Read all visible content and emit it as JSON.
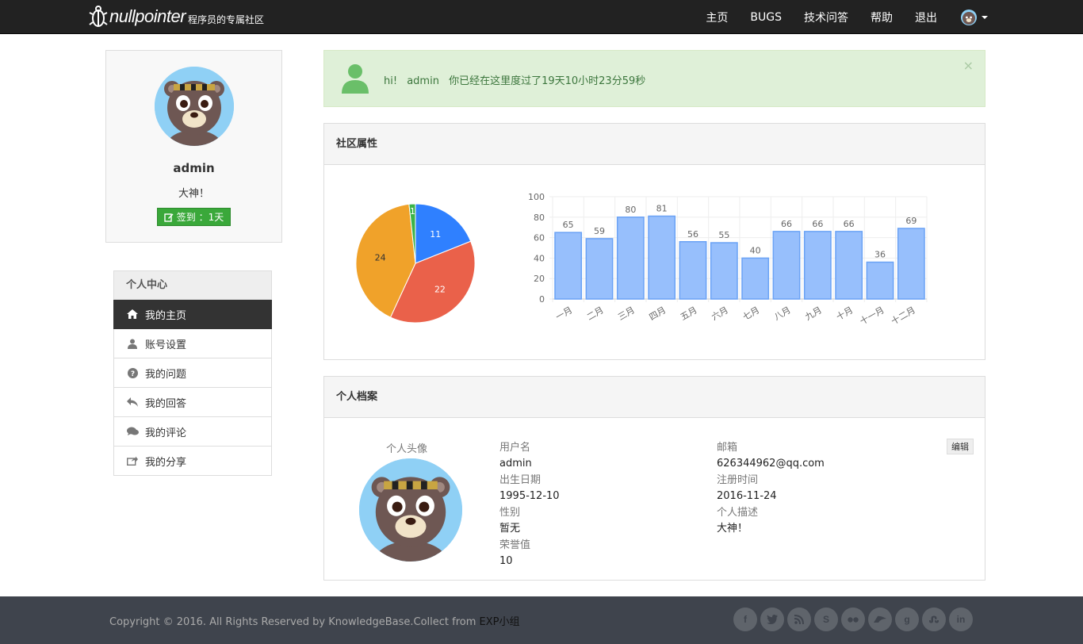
{
  "brand": {
    "name": "nullpointer",
    "tagline": "程序员的专属社区"
  },
  "nav": {
    "items": [
      "主页",
      "BUGS",
      "技术问答",
      "帮助",
      "退出"
    ]
  },
  "profile": {
    "name": "admin",
    "title": "大神！",
    "checkin_label": "签到 ：1天"
  },
  "menu": {
    "header": "个人中心",
    "items": [
      {
        "label": "我的主页",
        "icon": "home-icon",
        "active": true
      },
      {
        "label": "账号设置",
        "icon": "user-icon"
      },
      {
        "label": "我的问题",
        "icon": "question-circle-icon"
      },
      {
        "label": "我的回答",
        "icon": "reply-icon"
      },
      {
        "label": "我的评论",
        "icon": "comments-icon"
      },
      {
        "label": "我的分享",
        "icon": "share-icon"
      }
    ]
  },
  "alert": {
    "greeting": "hi!",
    "user": "admin",
    "message": "你已经在这里度过了19天10小时23分59秒",
    "close": "×"
  },
  "stats_panel": {
    "title": "社区属性"
  },
  "chart_data": [
    {
      "type": "pie",
      "slices": [
        {
          "label": "11",
          "value": 11,
          "color": "#2f80ff"
        },
        {
          "label": "22",
          "value": 22,
          "color": "#ea614a"
        },
        {
          "label": "24",
          "value": 24,
          "color": "#f0a22a"
        },
        {
          "label": "1",
          "value": 1,
          "color": "#3bb34a"
        }
      ]
    },
    {
      "type": "bar",
      "categories": [
        "一月",
        "二月",
        "三月",
        "四月",
        "五月",
        "六月",
        "七月",
        "八月",
        "九月",
        "十月",
        "十一月",
        "十二月"
      ],
      "values": [
        65,
        59,
        80,
        81,
        56,
        55,
        40,
        66,
        66,
        66,
        36,
        69
      ],
      "ylim": [
        0,
        100
      ],
      "yticks": [
        0,
        20,
        40,
        60,
        80,
        100
      ],
      "bar_color": "#97bffc",
      "bar_border": "#6aa2f5",
      "grid": true
    }
  ],
  "profile_panel": {
    "title": "个人档案",
    "avatar_label": "个人头像",
    "edit_label": "编辑",
    "left_fields": [
      {
        "label": "用户名",
        "value": "admin"
      },
      {
        "label": "出生日期",
        "value": "1995-12-10"
      },
      {
        "label": "性别",
        "value": "暂无"
      },
      {
        "label": "荣誉值",
        "value": "10"
      }
    ],
    "right_fields": [
      {
        "label": "邮箱",
        "value": "626344962@qq.com"
      },
      {
        "label": "注册时间",
        "value": "2016-11-24"
      },
      {
        "label": "个人描述",
        "value": "大神！"
      }
    ]
  },
  "footer": {
    "copyright": "Copyright © 2016. All Rights Reserved by KnowledgeBase.Collect from ",
    "group": "EXP小组",
    "socials": [
      "facebook-icon",
      "twitter-icon",
      "rss-icon",
      "skype-icon",
      "flickr-icon",
      "delicious-icon",
      "google-icon",
      "stumbleupon-icon",
      "linkedin-icon"
    ]
  }
}
